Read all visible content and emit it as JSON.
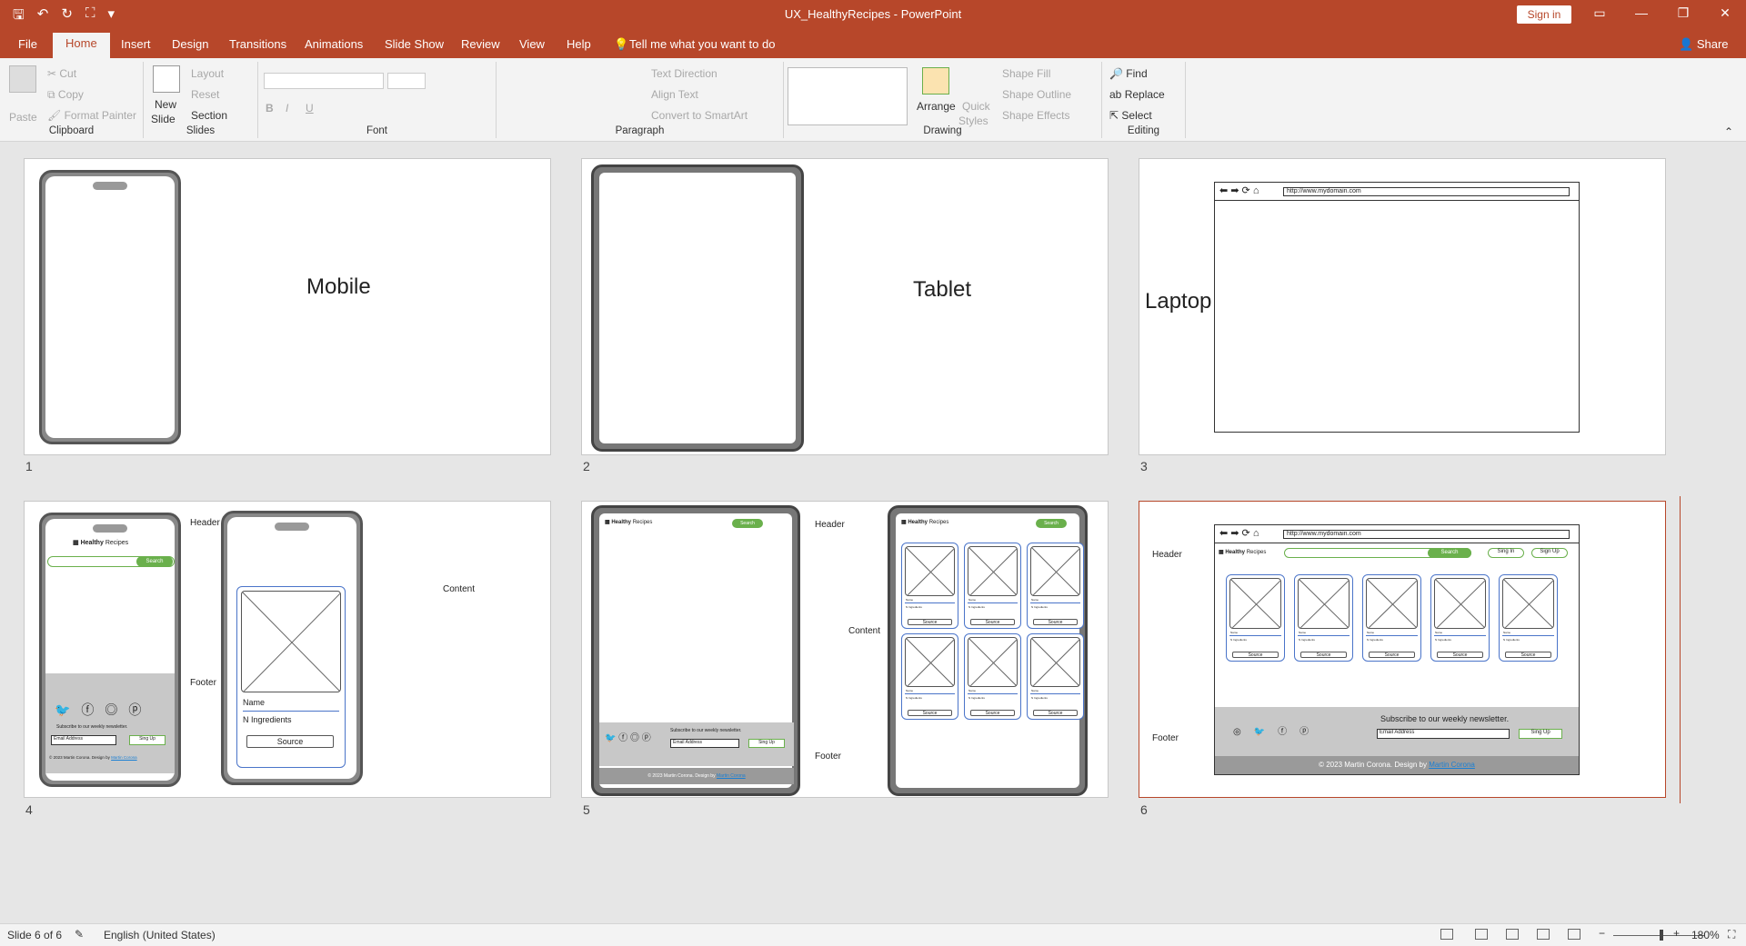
{
  "window": {
    "title": "UX_HealthyRecipes - PowerPoint",
    "sign_in": "Sign in",
    "share": "Share"
  },
  "tabs": [
    "File",
    "Home",
    "Insert",
    "Design",
    "Transitions",
    "Animations",
    "Slide Show",
    "Review",
    "View",
    "Help"
  ],
  "tell_me": "Tell me what you want to do",
  "ribbon": {
    "clipboard": {
      "label": "Clipboard",
      "paste": "Paste",
      "cut": "Cut",
      "copy": "Copy",
      "format_painter": "Format Painter"
    },
    "slides": {
      "label": "Slides",
      "new_slide": "New",
      "new_slide2": "Slide",
      "layout": "Layout",
      "reset": "Reset",
      "section": "Section"
    },
    "font": {
      "label": "Font"
    },
    "paragraph": {
      "label": "Paragraph",
      "text_direction": "Text Direction",
      "align_text": "Align Text",
      "convert": "Convert to SmartArt"
    },
    "drawing": {
      "label": "Drawing",
      "arrange": "Arrange",
      "quick_styles": "Quick",
      "quick_styles2": "Styles",
      "shape_fill": "Shape Fill",
      "shape_outline": "Shape Outline",
      "shape_effects": "Shape Effects"
    },
    "editing": {
      "label": "Editing",
      "find": "Find",
      "replace": "Replace",
      "select": "Select"
    }
  },
  "slides": [
    {
      "num": "1",
      "label": "Mobile"
    },
    {
      "num": "2",
      "label": "Tablet"
    },
    {
      "num": "3",
      "label": "Laptop",
      "url": "http://www.mydomain.com"
    },
    {
      "num": "4",
      "header": "Header",
      "content": "Content",
      "footer": "Footer",
      "brand": "Healthy",
      "brand2": "Recipes",
      "search": "Search",
      "newsletter": "Subscribe to our weekly newsletter.",
      "email": "Email Address",
      "signup": "Sing Up",
      "copyright": "© 2023 Martin Corona. Design by",
      "designer": "Martin Corona",
      "card_name": "Name",
      "card_ingredients": "N Ingredients",
      "card_source": "Source"
    },
    {
      "num": "5",
      "header": "Header",
      "content": "Content",
      "footer": "Footer",
      "brand": "Healthy",
      "brand2": "Recipes",
      "search": "Search",
      "newsletter": "Subscribe to our weekly newsletter.",
      "email": "Email Address",
      "signup": "Sing Up",
      "copyright": "© 2023 Martin Corona. Design by",
      "designer": "Martin Corona",
      "card_name": "Name",
      "card_ingredients": "N Ingredients",
      "card_source": "Source"
    },
    {
      "num": "6",
      "header": "Header",
      "footer": "Footer",
      "url": "http://www.mydomain.com",
      "brand": "Healthy",
      "brand2": "Recipes",
      "search": "Search",
      "sign_in": "Sing In",
      "sign_up": "Sign Up",
      "newsletter": "Subscribe to our weekly newsletter.",
      "email": "Email Address",
      "signup": "Sing Up",
      "copyright": "© 2023 Martin Corona. Design by",
      "designer": "Martin Corona",
      "card_name": "Name",
      "card_ingredients": "N Ingredients",
      "card_source": "Source"
    }
  ],
  "status": {
    "slide_of": "Slide 6 of 6",
    "language": "English (United States)",
    "zoom": "180%"
  },
  "colors": {
    "accent": "#b7472a",
    "green": "#6ab04c",
    "card_border": "#4a74c9"
  }
}
